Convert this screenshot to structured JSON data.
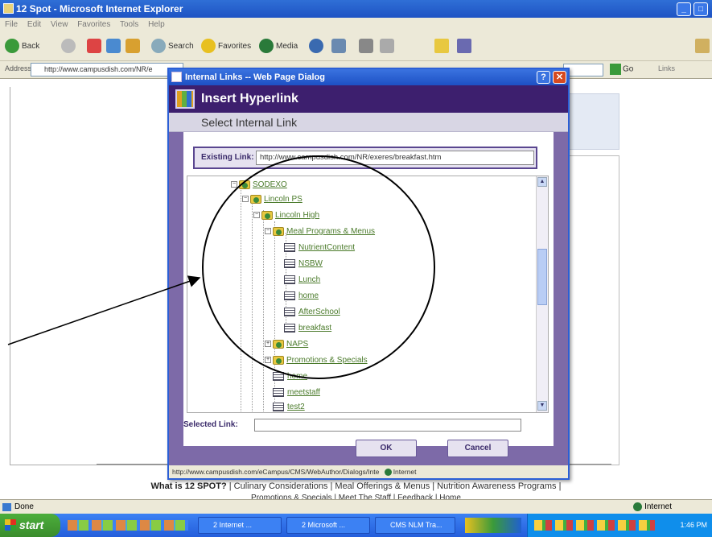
{
  "ie": {
    "title": "12 Spot - Microsoft Internet Explorer",
    "menu": [
      "File",
      "Edit",
      "View",
      "Favorites",
      "Tools",
      "Help"
    ],
    "toolbar": {
      "back": "Back",
      "search": "Search",
      "favorites": "Favorites",
      "media": "Media"
    },
    "address_label": "Address",
    "address_value": "http://www.campusdish.com/NR/e",
    "go": "Go",
    "links": "Links",
    "status_left": "Done",
    "status_zone": "Internet"
  },
  "page": {
    "footer_bold": "What is 12 SPOT?",
    "footer_links": " | Culinary Considerations | Meal Offerings & Menus | Nutrition Awareness Programs |",
    "footer_links2": "Promotions & Specials | Meet The Staff | Feedback | Home"
  },
  "dialog": {
    "title": "Internal Links -- Web Page Dialog",
    "header": "Insert Hyperlink",
    "subheader": "Select Internal Link",
    "existing_label": "Existing Link:",
    "existing_value": "http://www.campusdish.com/NR/exeres/breakfast.htm",
    "tree": [
      {
        "label": "SODEXO",
        "type": "folder"
      },
      {
        "label": "Lincoln PS",
        "type": "folder"
      },
      {
        "label": "Lincoln High",
        "type": "folder"
      },
      {
        "label": "Meal Programs & Menus",
        "type": "folder"
      },
      {
        "label": "NutrientContent",
        "type": "page"
      },
      {
        "label": "NSBW",
        "type": "page"
      },
      {
        "label": "Lunch",
        "type": "page"
      },
      {
        "label": "home",
        "type": "page"
      },
      {
        "label": "AfterSchool",
        "type": "page"
      },
      {
        "label": "breakfast",
        "type": "page"
      },
      {
        "label": "NAPS",
        "type": "folder"
      },
      {
        "label": "Promotions & Specials",
        "type": "folder"
      },
      {
        "label": "home",
        "type": "page"
      },
      {
        "label": "meetstaff",
        "type": "page"
      },
      {
        "label": "test2",
        "type": "page"
      }
    ],
    "selected_label": "Selected Link:",
    "selected_value": "",
    "ok": "OK",
    "cancel": "Cancel",
    "status": "http://www.campusdish.com/eCampus/CMS/WebAuthor/Dialogs/Inte",
    "status_zone": "Internet"
  },
  "taskbar": {
    "start": "start",
    "tasks": [
      "2 Internet ...",
      "2 Microsoft ...",
      "CMS NLM Tra..."
    ],
    "clock": "1:46 PM"
  },
  "colors": {
    "dialog_header": "#3d1f6e",
    "link_green": "#4a7a2a",
    "xp_blue": "#245edb"
  }
}
